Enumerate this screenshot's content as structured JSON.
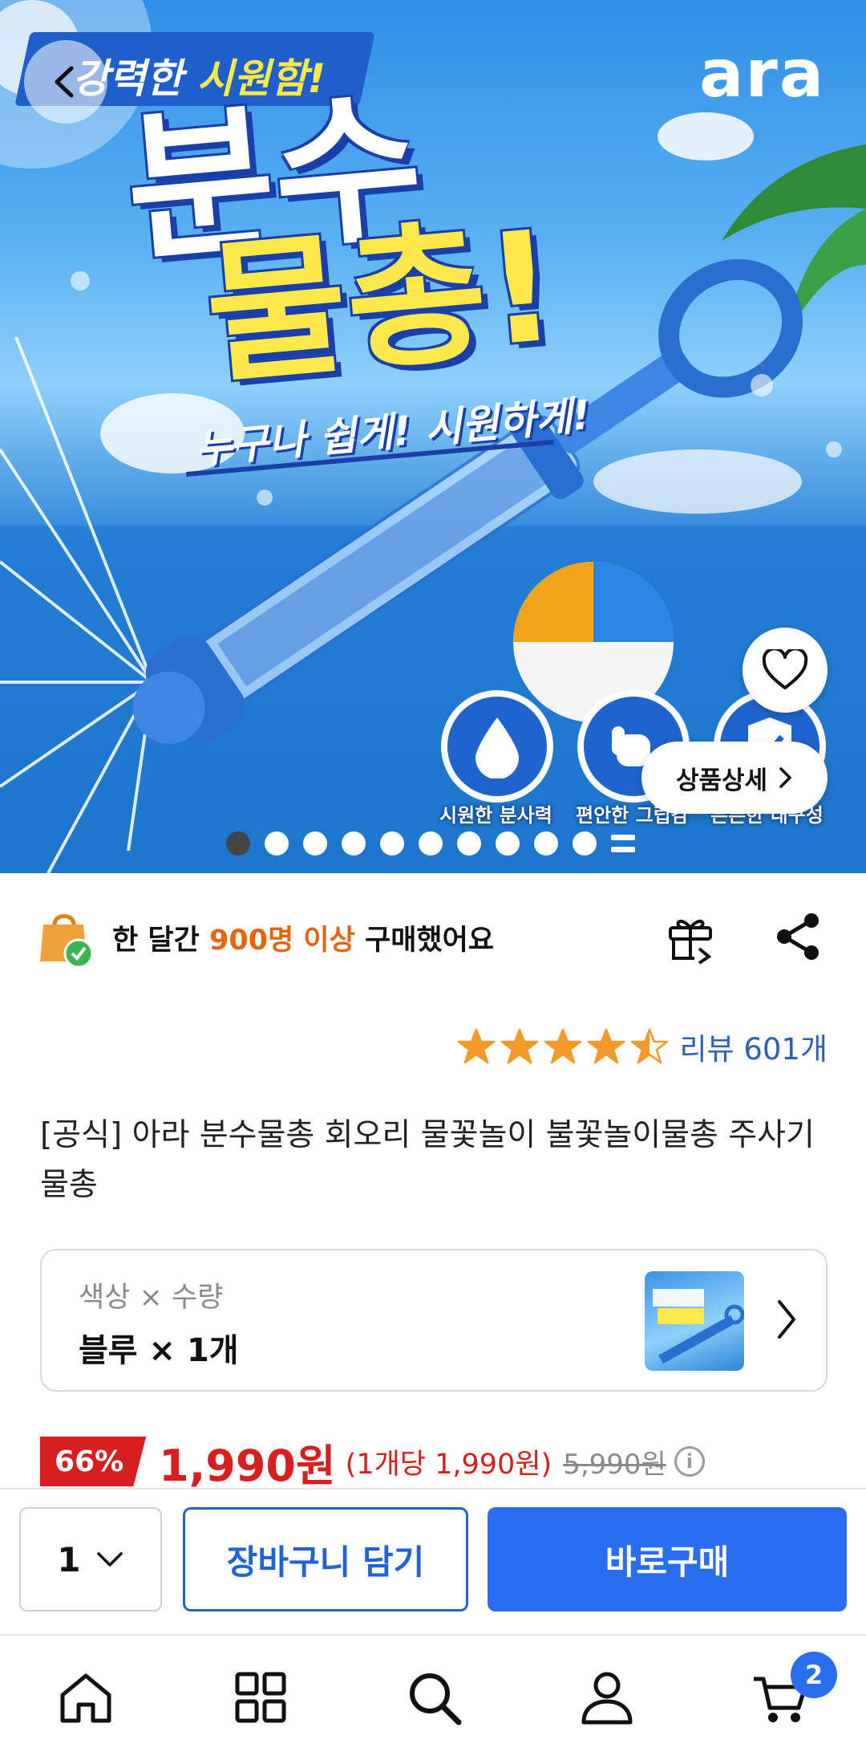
{
  "hero": {
    "tagline_white": "강력한 ",
    "tagline_yellow": "시원함!",
    "brand": "ara",
    "title_line1": "분수",
    "title_line2": "물총!",
    "subtitle": "누구나 쉽게! 시원하게!",
    "features": [
      "시원한 분사력",
      "편안한 그립감",
      "튼튼한 내구성"
    ],
    "detail_button": "상품상세",
    "image_count": 10,
    "active_image_index": 0
  },
  "social_proof": {
    "before": "한 달간 ",
    "highlight": "900명 이상",
    "after": " 구매했어요",
    "highlight_color": "#e5640e"
  },
  "rating": {
    "stars": 4.5,
    "review_label": "리뷰 601개"
  },
  "product": {
    "title": "[공식] 아라 분수물총 회오리 물꽃놀이 불꽃놀이물총 주사기물총"
  },
  "option": {
    "label": "색상 × 수량",
    "value": "블루 × 1개"
  },
  "price": {
    "discount": "66%",
    "sale": "1,990원",
    "unit": "(1개당 1,990원)",
    "original": "5,990원",
    "info_icon": "i"
  },
  "purchase": {
    "quantity": "1",
    "cart_button": "장바구니 담기",
    "buy_button": "바로구매",
    "accent_color": "#2a6ef0"
  },
  "tab_bar": {
    "items": [
      "home-icon",
      "category-grid-icon",
      "search-icon",
      "profile-icon",
      "cart-icon"
    ],
    "cart_count": "2"
  }
}
